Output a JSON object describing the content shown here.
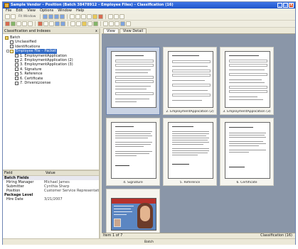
{
  "window": {
    "title": "Sample Vendor – Position (Batch 38478912 – Employee Files) – Classification (16)",
    "controls": [
      "_",
      "□",
      "x"
    ]
  },
  "menu": [
    "File",
    "Edit",
    "View",
    "Options",
    "Window",
    "Help"
  ],
  "toolbar": {
    "dropdown_label": "Fit Window"
  },
  "left_pane": {
    "title": "Classification and Indexes",
    "close": "x",
    "tree": [
      {
        "label": "Batch",
        "level": 0,
        "type": "folder"
      },
      {
        "label": "Unclassified",
        "level": 1,
        "type": "doc"
      },
      {
        "label": "Identifications",
        "level": 1,
        "type": "doc"
      },
      {
        "label": "Employee File – Packet",
        "level": 1,
        "type": "fld",
        "selected": true
      },
      {
        "label": "1. EmploymentApplication",
        "level": 2,
        "type": "doc"
      },
      {
        "label": "2. EmploymentApplication (2)",
        "level": 2,
        "type": "doc"
      },
      {
        "label": "3. EmploymentApplication (3)",
        "level": 2,
        "type": "doc"
      },
      {
        "label": "4. Signature",
        "level": 2,
        "type": "doc"
      },
      {
        "label": "5. Reference",
        "level": 2,
        "type": "doc"
      },
      {
        "label": "6. Certificate",
        "level": 2,
        "type": "doc"
      },
      {
        "label": "7. DriversLicense",
        "level": 2,
        "type": "doc"
      }
    ]
  },
  "properties": {
    "headers": [
      "Field",
      "Value"
    ],
    "rows": [
      {
        "key": "Batch Fields",
        "value": "",
        "section": true
      },
      {
        "key": "Hiring Manager",
        "value": "Michael James"
      },
      {
        "key": "Submitter",
        "value": "Cynthia Sharp"
      },
      {
        "key": "Position",
        "value": "Customer Service Representative"
      },
      {
        "key": "Package Level",
        "value": "",
        "section": true
      },
      {
        "key": "Hire Date",
        "value": "3/21/2007"
      }
    ]
  },
  "viewer": {
    "tabs": [
      "View",
      "View Detail"
    ],
    "thumbnails": [
      {
        "caption": "",
        "kind": "form",
        "selected": true
      },
      {
        "caption": "2. EmploymentApplication (2)",
        "kind": "form"
      },
      {
        "caption": "3. EmploymentApplication (3)",
        "kind": "form"
      },
      {
        "caption": "4. Signature",
        "kind": "text"
      },
      {
        "caption": "5. Reference",
        "kind": "text"
      },
      {
        "caption": "6. Certificate",
        "kind": "text"
      },
      {
        "caption": "",
        "kind": "photo"
      }
    ],
    "status_left": "Item 1 of 7",
    "status_right": "Classification (16)"
  },
  "bottom": {
    "label": "Batch"
  }
}
